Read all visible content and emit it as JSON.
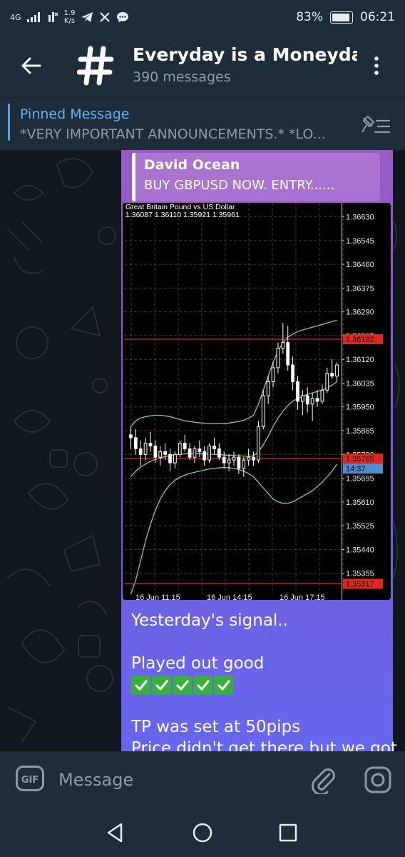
{
  "status_bar": {
    "network": "4G",
    "speed_value": "1.9",
    "speed_unit": "K/s",
    "battery": "83%",
    "time": "06:21"
  },
  "header": {
    "title": "Everyday is a Moneyday",
    "subtitle": "390 messages"
  },
  "pinned": {
    "label": "Pinned Message",
    "text": "*VERY IMPORTANT ANNOUNCEMENTS.*  *LO..."
  },
  "message": {
    "reply_author": "David Ocean",
    "reply_text": "BUY GBPUSD NOW.   ENTRY......",
    "line1": "Yesterday's signal..",
    "line2": "Played out good",
    "check_count": 5,
    "line3": "TP was set at 50pips",
    "line4": "Price didn't get there but we got"
  },
  "chart_data": {
    "type": "candlestick",
    "title": "Great Britain Pound vs US Dollar",
    "ohlc_header": "1.36087 1.36110 1.35921 1.35961",
    "price_ticks": [
      "1.36630",
      "1.36545",
      "1.36460",
      "1.36375",
      "1.36290",
      "1.36205",
      "1.36120",
      "1.36035",
      "1.35950",
      "1.35865",
      "1.35780",
      "1.35695",
      "1.35610",
      "1.35525",
      "1.35440",
      "1.35355"
    ],
    "ylim": [
      1.3528,
      1.3668
    ],
    "time_labels": [
      "16 Jun 11:15",
      "16 Jun 14:15",
      "16 Jun 17:15"
    ],
    "horizontal_lines": [
      {
        "price": 1.36192,
        "label": "1.36192",
        "color": "#e1261c"
      },
      {
        "price": 1.35765,
        "label": "1.35765",
        "color": "#e1261c"
      },
      {
        "price": 1.35317,
        "label": "1.35317",
        "color": "#e1261c"
      }
    ],
    "current_time_label": "14:37",
    "candles": [
      [
        1.3585,
        1.3588,
        1.358,
        1.3584
      ],
      [
        1.3584,
        1.3587,
        1.3578,
        1.358
      ],
      [
        1.358,
        1.3583,
        1.3574,
        1.3578
      ],
      [
        1.3578,
        1.3584,
        1.3576,
        1.3582
      ],
      [
        1.3582,
        1.3586,
        1.3579,
        1.3581
      ],
      [
        1.3581,
        1.3583,
        1.3575,
        1.3577
      ],
      [
        1.3577,
        1.3581,
        1.3574,
        1.3579
      ],
      [
        1.3579,
        1.3582,
        1.3576,
        1.3578
      ],
      [
        1.3578,
        1.358,
        1.3572,
        1.3575
      ],
      [
        1.3575,
        1.3579,
        1.3573,
        1.3578
      ],
      [
        1.3578,
        1.3583,
        1.3577,
        1.3582
      ],
      [
        1.3582,
        1.3585,
        1.3579,
        1.358
      ],
      [
        1.358,
        1.3582,
        1.3576,
        1.3577
      ],
      [
        1.3577,
        1.3581,
        1.3575,
        1.358
      ],
      [
        1.358,
        1.3583,
        1.3577,
        1.3579
      ],
      [
        1.3579,
        1.3581,
        1.3574,
        1.3576
      ],
      [
        1.3576,
        1.3582,
        1.3575,
        1.3581
      ],
      [
        1.3581,
        1.3584,
        1.3578,
        1.358
      ],
      [
        1.358,
        1.3582,
        1.3576,
        1.3577
      ],
      [
        1.3577,
        1.3579,
        1.3573,
        1.3575
      ],
      [
        1.3575,
        1.3578,
        1.3572,
        1.3576
      ],
      [
        1.3576,
        1.3579,
        1.3574,
        1.3577
      ],
      [
        1.3577,
        1.3578,
        1.3571,
        1.3573
      ],
      [
        1.3573,
        1.3577,
        1.357,
        1.3576
      ],
      [
        1.3576,
        1.358,
        1.3574,
        1.3577
      ],
      [
        1.3577,
        1.3579,
        1.3574,
        1.3576
      ],
      [
        1.3576,
        1.359,
        1.3575,
        1.3588
      ],
      [
        1.3588,
        1.3601,
        1.3587,
        1.3599
      ],
      [
        1.3599,
        1.3606,
        1.3596,
        1.3604
      ],
      [
        1.3604,
        1.3611,
        1.3602,
        1.3609
      ],
      [
        1.3609,
        1.3618,
        1.3607,
        1.3616
      ],
      [
        1.3616,
        1.3625,
        1.3614,
        1.3618
      ],
      [
        1.3618,
        1.3624,
        1.3608,
        1.361
      ],
      [
        1.361,
        1.3613,
        1.3601,
        1.3604
      ],
      [
        1.3604,
        1.3606,
        1.3594,
        1.3597
      ],
      [
        1.3597,
        1.3601,
        1.3592,
        1.3599
      ],
      [
        1.3599,
        1.3602,
        1.3593,
        1.3596
      ],
      [
        1.3596,
        1.36,
        1.359,
        1.3598
      ],
      [
        1.3598,
        1.3601,
        1.3595,
        1.3597
      ],
      [
        1.3597,
        1.3603,
        1.3596,
        1.3601
      ],
      [
        1.3601,
        1.3609,
        1.36,
        1.3607
      ],
      [
        1.3607,
        1.3612,
        1.3605,
        1.3606
      ],
      [
        1.3606,
        1.3611,
        1.3604,
        1.361
      ]
    ],
    "bands": {
      "upper": [
        1.3588,
        1.359,
        1.3591,
        1.35915,
        1.35918,
        1.3592,
        1.3592,
        1.35918,
        1.35915,
        1.3591,
        1.35905,
        1.359,
        1.35898,
        1.35895,
        1.35893,
        1.35892,
        1.3589,
        1.3589,
        1.3589,
        1.3589,
        1.35892,
        1.35895,
        1.35898,
        1.35902,
        1.3591,
        1.3592,
        1.3596,
        1.3601,
        1.3606,
        1.3611,
        1.3615,
        1.3618,
        1.362,
        1.3621,
        1.3622,
        1.36225,
        1.3623,
        1.36235,
        1.3624,
        1.36245,
        1.3625,
        1.36255,
        1.3626
      ],
      "middle": [
        1.357,
        1.3572,
        1.35735,
        1.35745,
        1.35755,
        1.35762,
        1.35768,
        1.35772,
        1.35776,
        1.35779,
        1.35781,
        1.35782,
        1.35783,
        1.35783,
        1.35783,
        1.35782,
        1.35781,
        1.3578,
        1.35779,
        1.35778,
        1.35777,
        1.35776,
        1.35775,
        1.35774,
        1.35773,
        1.35775,
        1.3579,
        1.35815,
        1.35845,
        1.3588,
        1.3591,
        1.35935,
        1.35955,
        1.3597,
        1.3598,
        1.35988,
        1.35995,
        1.36,
        1.36005,
        1.3601,
        1.36018,
        1.36028,
        1.3604
      ],
      "lower": [
        1.3528,
        1.3533,
        1.354,
        1.3547,
        1.3553,
        1.3558,
        1.3562,
        1.3565,
        1.35672,
        1.35688,
        1.35698,
        1.35706,
        1.35712,
        1.35716,
        1.3572,
        1.35724,
        1.35728,
        1.3573,
        1.35732,
        1.35733,
        1.35732,
        1.3573,
        1.35726,
        1.3572,
        1.35712,
        1.357,
        1.3568,
        1.3566,
        1.3564,
        1.3562,
        1.3561,
        1.35605,
        1.35605,
        1.3561,
        1.3562,
        1.3563,
        1.3564,
        1.3565,
        1.35665,
        1.3568,
        1.357,
        1.3572,
        1.35745
      ]
    }
  },
  "composer": {
    "placeholder": "Message",
    "gif_label": "GIF"
  },
  "colors": {
    "bar_bg": "#1f2d3a",
    "accent": "#5eb0ef",
    "bubble_top": "#9c59c6",
    "bubble_bottom": "#6566ef"
  }
}
